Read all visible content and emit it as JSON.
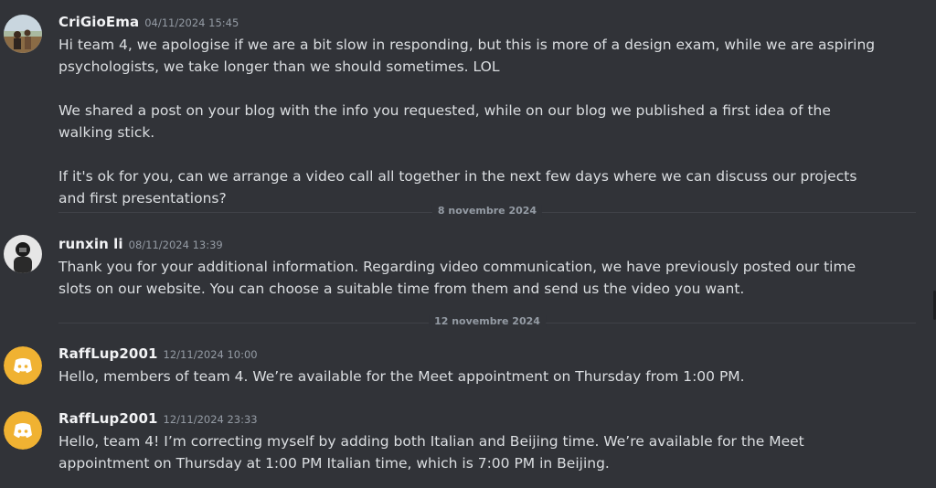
{
  "messages": [
    {
      "username": "CriGioEma",
      "timestamp": "04/11/2024 15:45",
      "avatar": "photo-avatar",
      "lines": [
        "Hi team 4, we apologise if we are a bit slow in responding, but this is more of a design exam, while we are aspiring psychologists, we take longer than we should sometimes. LOL",
        "We shared a post on your blog with the info you requested, while on our blog we published a first idea of the walking stick.",
        "If it's ok  for you, can we arrange a video call all together in the next few days where we can discuss our projects and first presentations?"
      ]
    },
    {
      "username": "runxin li",
      "timestamp": "08/11/2024 13:39",
      "avatar": "photo-avatar",
      "lines": [
        "Thank you for your additional information. Regarding video communication, we have previously posted our time slots on our website. You can choose a suitable time from them and send us the video you want."
      ]
    },
    {
      "username": "RaffLup2001",
      "timestamp": "12/11/2024 10:00",
      "avatar": "discord-icon",
      "lines": [
        "Hello, members of team 4. We’re available for the Meet appointment on Thursday from 1:00 PM."
      ]
    },
    {
      "username": "RaffLup2001",
      "timestamp": "12/11/2024 23:33",
      "avatar": "discord-icon",
      "lines": [
        "Hello, team 4! I’m correcting myself by adding both Italian and Beijing time. We’re available for the Meet appointment on Thursday at 1:00 PM Italian time, which is 7:00 PM in Beijing."
      ]
    }
  ],
  "dividers": [
    "8 novembre 2024",
    "12 novembre 2024"
  ],
  "colors": {
    "background": "#313338",
    "text": "#dbdee1",
    "username": "#f2f3f5",
    "muted": "#949ba4",
    "discord_avatar": "#f0b232"
  }
}
